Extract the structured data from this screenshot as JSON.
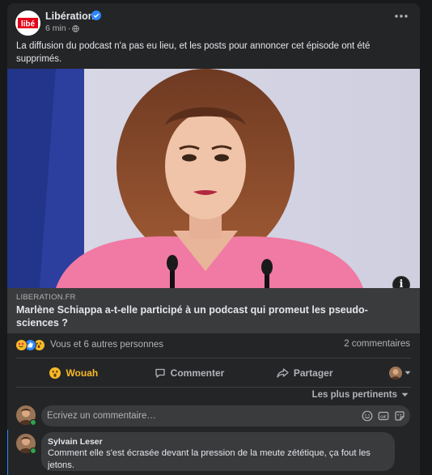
{
  "post": {
    "page_name": "Libération",
    "logo_text": "libé",
    "time": "6 min",
    "time_sep": "·",
    "text": "La diffusion du podcast n'a pas eu lieu, et les posts pour annoncer cet épisode ont été supprimés."
  },
  "link": {
    "domain": "LIBERATION.FR",
    "title": "Marlène Schiappa a-t-elle participé à un podcast qui promeut les pseudo-sciences ?"
  },
  "stats": {
    "reactions_text": "Vous et 6 autres personnes",
    "comments_count": "2 commentaires"
  },
  "actions": {
    "wow": "Wouah",
    "comment": "Commenter",
    "share": "Partager"
  },
  "comments": {
    "sort_label": "Les plus pertinents",
    "input_placeholder": "Écrivez un commentaire…",
    "items": [
      {
        "author": "Sylvain Leser",
        "text": "Comment elle s'est écrasée devant la pression de la meute zététique, ça fout les jetons."
      }
    ]
  },
  "colors": {
    "accent": "#2d88ff",
    "wow": "#f7b928",
    "online": "#31a24c",
    "card": "#242526",
    "link_box": "#3a3b3c"
  },
  "icons": [
    "verified-badge-icon",
    "globe-icon",
    "more-icon",
    "info-icon",
    "wow-reaction-icon",
    "like-reaction-icon",
    "comment-icon",
    "share-icon",
    "chevron-down-icon",
    "emoji-icon",
    "gif-icon",
    "sticker-icon"
  ]
}
